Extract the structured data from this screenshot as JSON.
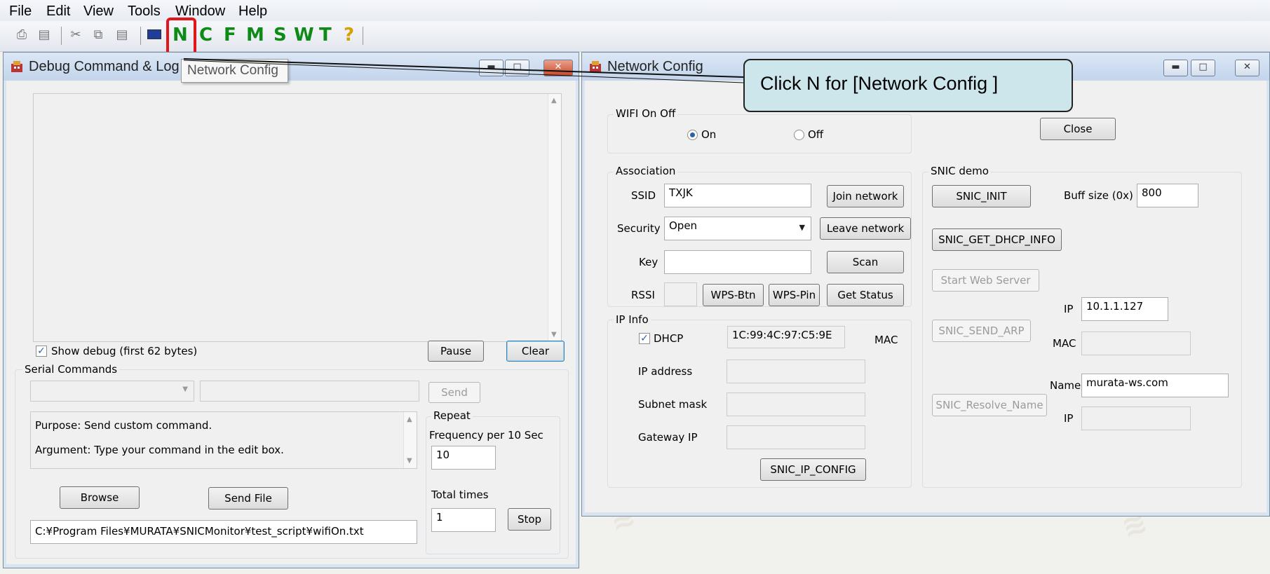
{
  "menu": [
    "File",
    "Edit",
    "View",
    "Tools",
    "Window",
    "Help"
  ],
  "toolbar": {
    "letters": [
      "N",
      "C",
      "F",
      "M",
      "S",
      "W",
      "T",
      "?"
    ],
    "icons": [
      "print-icon",
      "print-preview-icon",
      "cut-icon",
      "copy-icon",
      "paste-icon",
      "flag-icon"
    ]
  },
  "tooltip": "Network Config",
  "callout": "Click N for [Network Config ]",
  "debug_window": {
    "title": "Debug Command & Log",
    "show_debug_label": "Show debug (first 62 bytes)",
    "show_debug_checked": true,
    "pause_label": "Pause",
    "clear_label": "Clear",
    "serial_group_label": "Serial Commands",
    "command_select_value": "",
    "command_input_value": "",
    "send_label": "Send",
    "purpose_text": "Purpose: Send custom command.",
    "argument_text": "Argument: Type your command in the edit box.",
    "repeat_group_label": "Repeat",
    "frequency_label": "Frequency per  10 Sec",
    "frequency_value": "10",
    "total_times_label": "Total times",
    "total_times_value": "1",
    "stop_label": "Stop",
    "browse_label": "Browse",
    "send_file_label": "Send File",
    "file_path": "C:¥Program Files¥MURATA¥SNICMonitor¥test_script¥wifiOn.txt"
  },
  "network_window": {
    "title": "Network Config",
    "wifi_group_label": "WIFI On Off",
    "wifi_on_label": "On",
    "wifi_off_label": "Off",
    "wifi_state": "On",
    "close_label": "Close",
    "association_label": "Association",
    "ssid_label": "SSID",
    "ssid_value": "TXJK",
    "join_label": "Join network",
    "security_label": "Security",
    "security_value": "Open",
    "leave_label": "Leave network",
    "key_label": "Key",
    "key_value": "",
    "scan_label": "Scan",
    "rssi_label": "RSSI",
    "rssi_value": "",
    "wps_btn_label": "WPS-Btn",
    "wps_pin_label": "WPS-Pin",
    "get_status_label": "Get Status",
    "ipinfo_label": "IP Info",
    "dhcp_label": "DHCP",
    "dhcp_checked": true,
    "mac_value": "1C:99:4C:97:C5:9E",
    "mac_label": "MAC",
    "ip_address_label": "IP address",
    "subnet_label": "Subnet mask",
    "gateway_label": "Gateway IP",
    "ip_config_label": "SNIC_IP_CONFIG",
    "snic_demo_label": "SNIC demo",
    "snic_init_label": "SNIC_INIT",
    "buff_size_label": "Buff size (0x)",
    "buff_size_value": "800",
    "dhcp_info_label": "SNIC_GET_DHCP_INFO",
    "web_server_label": "Start Web Server",
    "arp_ip_label": "IP",
    "arp_ip_value": "10.1.1.127",
    "send_arp_label": "SNIC_SEND_ARP",
    "arp_mac_label": "MAC",
    "arp_mac_value": "",
    "name_label": "Name",
    "name_value": "murata-ws.com",
    "resolve_label": "SNIC_Resolve_Name",
    "resolve_ip_label": "IP",
    "resolve_ip_value": ""
  }
}
